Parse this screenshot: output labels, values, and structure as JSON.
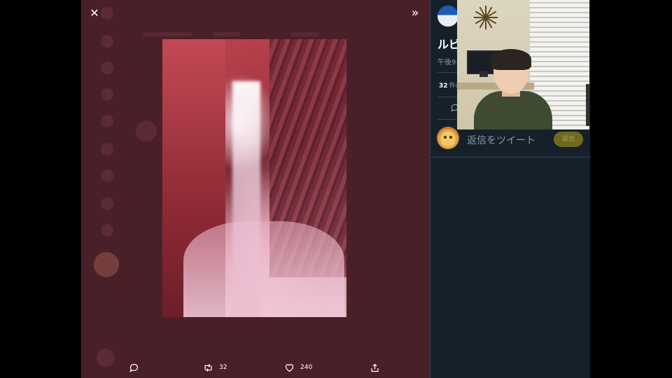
{
  "viewer": {
    "close_label": "✕",
    "expand_label": "»",
    "image_description": "Underground waterfall in a red-lit cave",
    "actions": {
      "reply": {
        "count": ""
      },
      "retweet": {
        "count": "32"
      },
      "like": {
        "count": "240"
      },
      "share": {
        "count": ""
      }
    }
  },
  "side": {
    "author_name": "ルビ",
    "time_text": "午後9:",
    "stats_count": "32",
    "stats_label": "件の",
    "reply_placeholder": "返信をツイート",
    "reply_button": "返信"
  },
  "colors": {
    "viewer_bg": "#4a2028",
    "side_bg": "#15202b",
    "divider": "#38444d",
    "muted_text": "#8899a6",
    "reply_button_bg": "#6e6a20"
  },
  "icons": [
    "close-icon",
    "expand-icon",
    "reply-icon",
    "retweet-icon",
    "like-icon",
    "share-icon",
    "comment-icon"
  ]
}
